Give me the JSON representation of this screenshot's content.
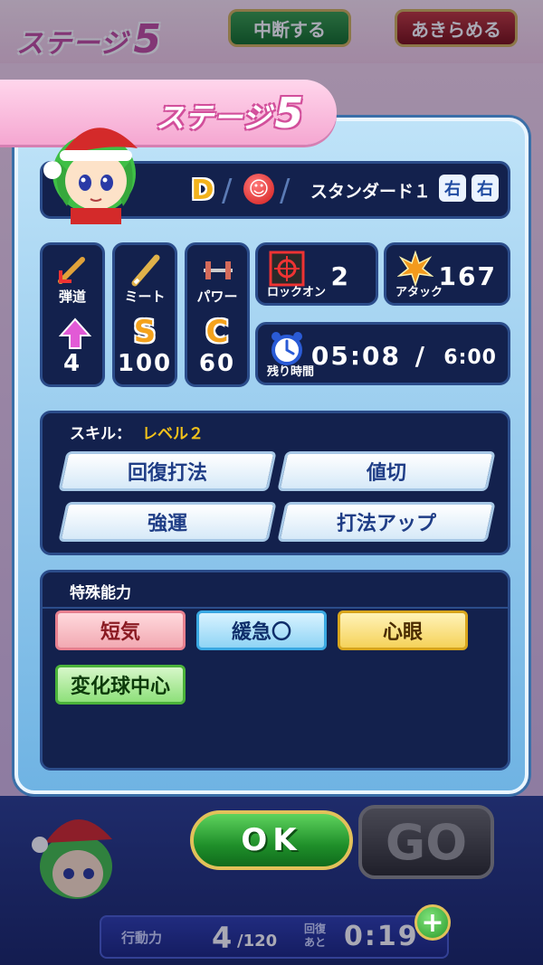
{
  "background": {
    "stage_word": "ステージ",
    "stage_number": "5",
    "pause_label": "中断する",
    "giveup_label": "あきらめる"
  },
  "dialog": {
    "stage_word": "ステージ",
    "stage_number": "5",
    "header": {
      "rank": "D",
      "type": "スタンダード１",
      "throw_hand": "右",
      "bat_hand": "右"
    },
    "stats": [
      {
        "label": "弾道",
        "value": "4",
        "icon": "trajectory-icon"
      },
      {
        "label": "ミート",
        "grade": "S",
        "value": "100",
        "icon": "bat-icon"
      },
      {
        "label": "パワー",
        "grade": "C",
        "value": "60",
        "icon": "barbell-icon"
      }
    ],
    "lockon": {
      "label": "ロックオン",
      "value": "2"
    },
    "attack": {
      "label": "アタック",
      "value": "167"
    },
    "time": {
      "label": "残り時間",
      "value": "05:08",
      "max": "6:00"
    },
    "skills": {
      "title": "スキル：",
      "level": "レベル２",
      "items": [
        "回復打法",
        "値切",
        "強運",
        "打法アップ"
      ]
    },
    "abilities": {
      "title": "特殊能力",
      "items": [
        {
          "label": "短気",
          "kind": "negative"
        },
        {
          "label": "緩急〇",
          "kind": "blue"
        },
        {
          "label": "心眼",
          "kind": "gold"
        },
        {
          "label": "変化球中心",
          "kind": "green"
        }
      ]
    }
  },
  "hud": {
    "ok_label": "OK",
    "go_label": "GO",
    "energy_label": "行動力",
    "energy_current": "4",
    "energy_max": "/120",
    "recover_label_1": "回復",
    "recover_label_2": "あと",
    "recover_time": "0:19",
    "plus_label": "+"
  },
  "colors": {
    "panel": "#13214d",
    "accent_pink": "#f5a7d1",
    "grade_orange": "#f4a21d",
    "ok_green": "#1f8f2a"
  }
}
